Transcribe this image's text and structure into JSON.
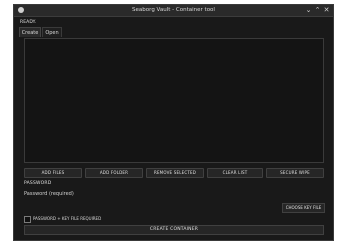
{
  "window": {
    "title": "Seaborg Vault - Container tool",
    "app_icon": "dot-icon",
    "controls": {
      "minimize": "⌄",
      "maximize": "⌃",
      "close": "✕"
    }
  },
  "status": "READY.",
  "tabs": [
    {
      "label": "Create",
      "active": true
    },
    {
      "label": "Open",
      "active": false
    }
  ],
  "file_list": {
    "items": []
  },
  "actions": {
    "add_files": "ADD FILES",
    "add_folder": "ADD FOLDER",
    "remove_selected": "REMOVE SELECTED",
    "clear_list": "CLEAR LIST",
    "secure_wipe": "SECURE WIPE"
  },
  "password": {
    "label": "PASSWORD",
    "placeholder": "Password (required)"
  },
  "keyfile_button": "CHOOSE KEY FILE",
  "require_keyfile": {
    "label": "PASSWORD + KEY FILE REQUIRED",
    "checked": false
  },
  "create_button": "CREATE CONTAINER",
  "colors": {
    "background": "#191919",
    "titlebar": "#2a2a2a",
    "button": "#262626",
    "text": "#e0e0e0"
  }
}
